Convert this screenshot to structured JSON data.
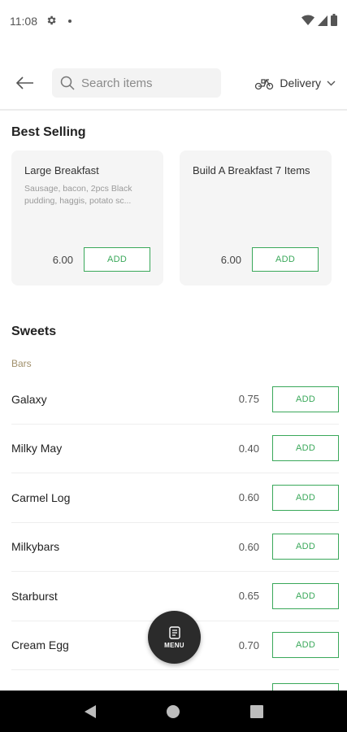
{
  "status_bar": {
    "time": "11:08"
  },
  "header": {
    "search_placeholder": "Search items",
    "delivery_label": "Delivery"
  },
  "best_selling": {
    "title": "Best Selling",
    "items": [
      {
        "name": "Large Breakfast",
        "description": "Sausage, bacon, 2pcs Black pudding, haggis, potato sc...",
        "price": "6.00",
        "add_label": "ADD"
      },
      {
        "name": "Build A Breakfast 7 Items",
        "description": "",
        "price": "6.00",
        "add_label": "ADD"
      }
    ]
  },
  "sweets": {
    "title": "Sweets",
    "subcategory": "Bars",
    "items": [
      {
        "name": "Galaxy",
        "price": "0.75",
        "add_label": "ADD"
      },
      {
        "name": "Milky May",
        "price": "0.40",
        "add_label": "ADD"
      },
      {
        "name": "Carmel Log",
        "price": "0.60",
        "add_label": "ADD"
      },
      {
        "name": "Milkybars",
        "price": "0.60",
        "add_label": "ADD"
      },
      {
        "name": "Starburst",
        "price": "0.65",
        "add_label": "ADD"
      },
      {
        "name": "Cream Egg",
        "price": "0.70",
        "add_label": "ADD"
      }
    ]
  },
  "fab": {
    "label": "MENU",
    "icon": "menu-document-icon"
  },
  "colors": {
    "accent_green": "#3aa85a",
    "subcategory": "#a08f6a",
    "fab_bg": "#2b2b2b"
  }
}
